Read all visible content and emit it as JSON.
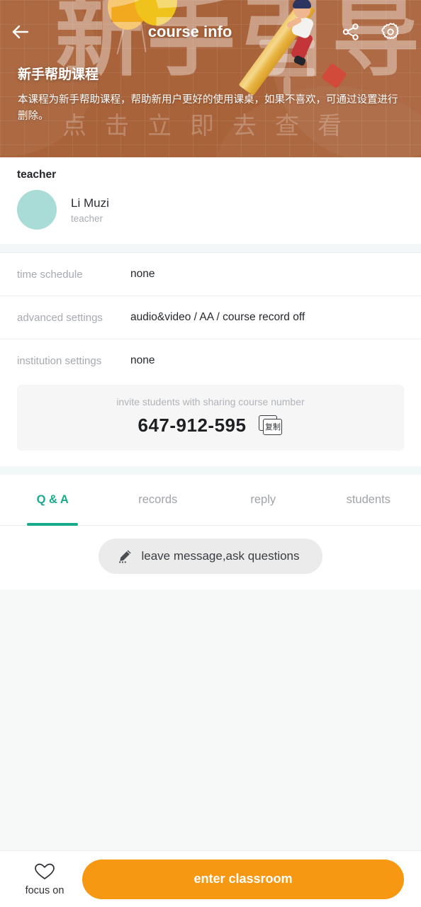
{
  "header": {
    "title": "course info",
    "back_icon": "arrow-left-icon",
    "share_icon": "share-icon",
    "settings_icon": "gear-icon",
    "course_title": "新手帮助课程",
    "course_desc": "本课程为新手帮助课程，帮助新用户更好的使用课桌，如果不喜欢，可通过设置进行删除。",
    "watermark_big": "新手引导",
    "watermark_small": "点击立即去查看",
    "bg_color": "#a9633a"
  },
  "teacher": {
    "section_label": "teacher",
    "name": "Li Muzi",
    "role": "teacher",
    "avatar_color": "#a9dcd6"
  },
  "info_rows": [
    {
      "label": "time schedule",
      "value": "none"
    },
    {
      "label": "advanced settings",
      "value": "audio&video  / AA / course record off"
    },
    {
      "label": "institution settings",
      "value": "none"
    }
  ],
  "invite": {
    "caption": "invite students with sharing course number",
    "code": "647-912-595",
    "copy_label": "复制",
    "copy_icon": "copy-icon"
  },
  "tabs": [
    {
      "label": "Q & A",
      "active": true
    },
    {
      "label": "records",
      "active": false
    },
    {
      "label": "reply",
      "active": false
    },
    {
      "label": "students",
      "active": false
    }
  ],
  "tab_accent_color": "#18ab8b",
  "message_button": {
    "label": "leave message,ask questions",
    "icon": "pencil-icon"
  },
  "bottom_bar": {
    "focus_label": "focus on",
    "focus_icon": "heart-icon",
    "enter_label": "enter classroom",
    "enter_color": "#f79812"
  }
}
